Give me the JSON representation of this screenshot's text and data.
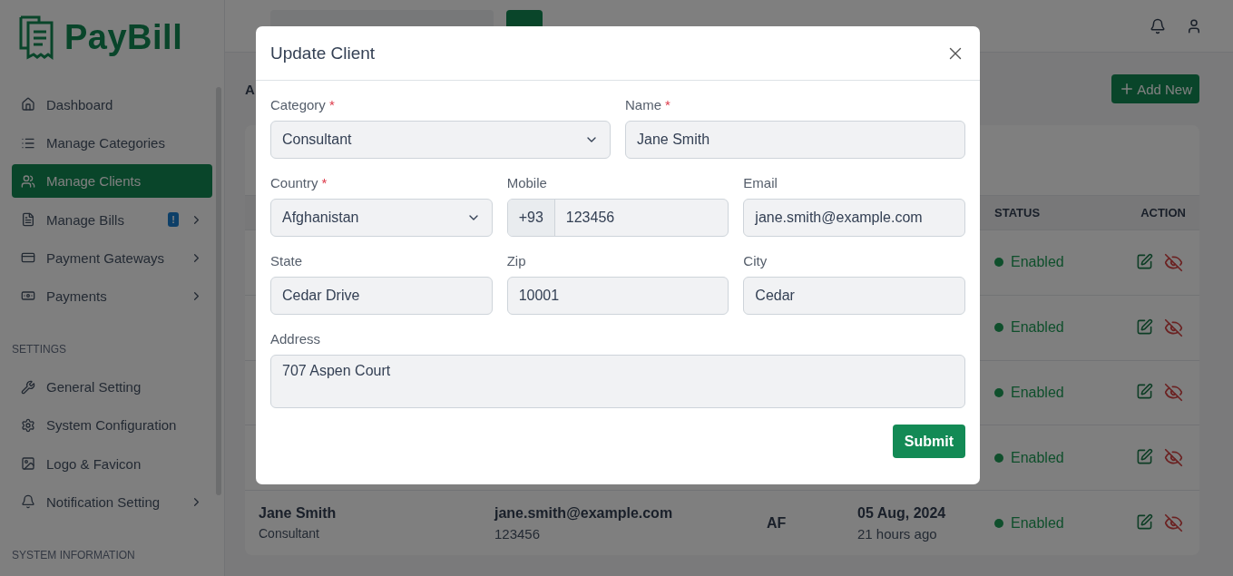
{
  "logo": "PayBill",
  "sidebar": {
    "groups": [
      {
        "items": [
          {
            "label": "Dashboard",
            "selected": false,
            "has_submenu": false
          },
          {
            "label": "Manage Categories",
            "selected": false,
            "has_submenu": false
          },
          {
            "label": "Manage Clients",
            "selected": true,
            "has_submenu": false
          },
          {
            "label": "Manage Bills",
            "selected": false,
            "has_submenu": true,
            "badge": "!"
          },
          {
            "label": "Payment Gateways",
            "selected": false,
            "has_submenu": true
          },
          {
            "label": "Payments",
            "selected": false,
            "has_submenu": true
          }
        ]
      },
      {
        "heading": "SETTINGS",
        "items": [
          {
            "label": "General Setting",
            "selected": false,
            "has_submenu": false
          },
          {
            "label": "System Configuration",
            "selected": false,
            "has_submenu": false
          },
          {
            "label": "Logo & Favicon",
            "selected": false,
            "has_submenu": false
          },
          {
            "label": "Notification Setting",
            "selected": false,
            "has_submenu": true
          }
        ]
      },
      {
        "heading": "SYSTEM INFORMATION"
      }
    ]
  },
  "page": {
    "heading": "A",
    "add_button": "Add New"
  },
  "table": {
    "columns": [
      {
        "label": "STATUS"
      },
      {
        "label": "ACTION"
      }
    ],
    "rows": [
      {
        "status": "Enabled"
      },
      {
        "status": "Enabled"
      },
      {
        "status": "Enabled"
      },
      {
        "status": "Enabled"
      },
      {
        "name": "Jane Smith",
        "category": "Consultant",
        "email": "jane.smith@example.com",
        "mobile": "123456",
        "country": "AF",
        "date": "05 Aug, 2024",
        "time_ago": "21 hours ago",
        "status": "Enabled"
      }
    ]
  },
  "modal": {
    "title": "Update Client",
    "rows": [
      {
        "fields": [
          {
            "label": "Category",
            "required_mark": "*",
            "kind": "select",
            "value": "Consultant"
          },
          {
            "label": "Name",
            "required_mark": "*",
            "kind": "text",
            "value": "Jane Smith"
          }
        ]
      },
      {
        "fields": [
          {
            "label": "Country",
            "required_mark": "*",
            "kind": "select",
            "value": "Afghanistan"
          },
          {
            "label": "Mobile",
            "kind": "phone",
            "prefix": "+93",
            "value": "123456"
          },
          {
            "label": "Email",
            "kind": "text",
            "value": "jane.smith@example.com"
          }
        ]
      },
      {
        "fields": [
          {
            "label": "State",
            "kind": "text",
            "value": "Cedar Drive"
          },
          {
            "label": "Zip",
            "kind": "text",
            "value": "10001"
          },
          {
            "label": "City",
            "kind": "text",
            "value": "Cedar"
          }
        ]
      },
      {
        "fields": [
          {
            "label": "Address",
            "kind": "textarea",
            "value": "707 Aspen Court"
          }
        ]
      }
    ],
    "submit": "Submit"
  }
}
